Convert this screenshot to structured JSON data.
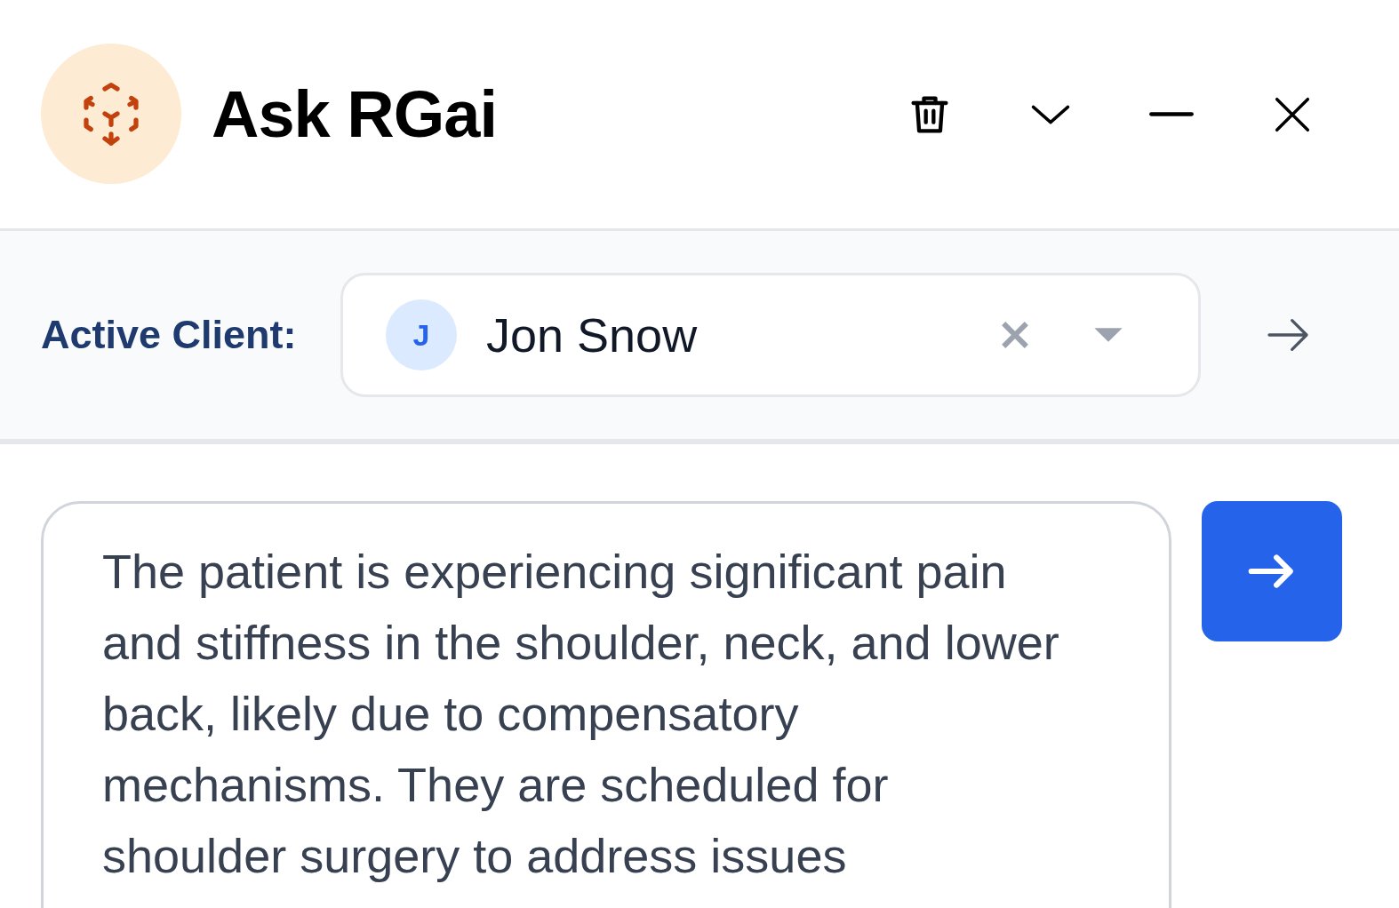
{
  "header": {
    "title": "Ask RGai"
  },
  "client_bar": {
    "label": "Active Client:",
    "client": {
      "initial": "J",
      "name": "Jon Snow"
    }
  },
  "composer": {
    "value": "The patient is experiencing significant pain and stiffness in the shoulder, neck, and lower back, likely due to compensatory mechanisms. They are scheduled for shoulder surgery to address issues"
  }
}
